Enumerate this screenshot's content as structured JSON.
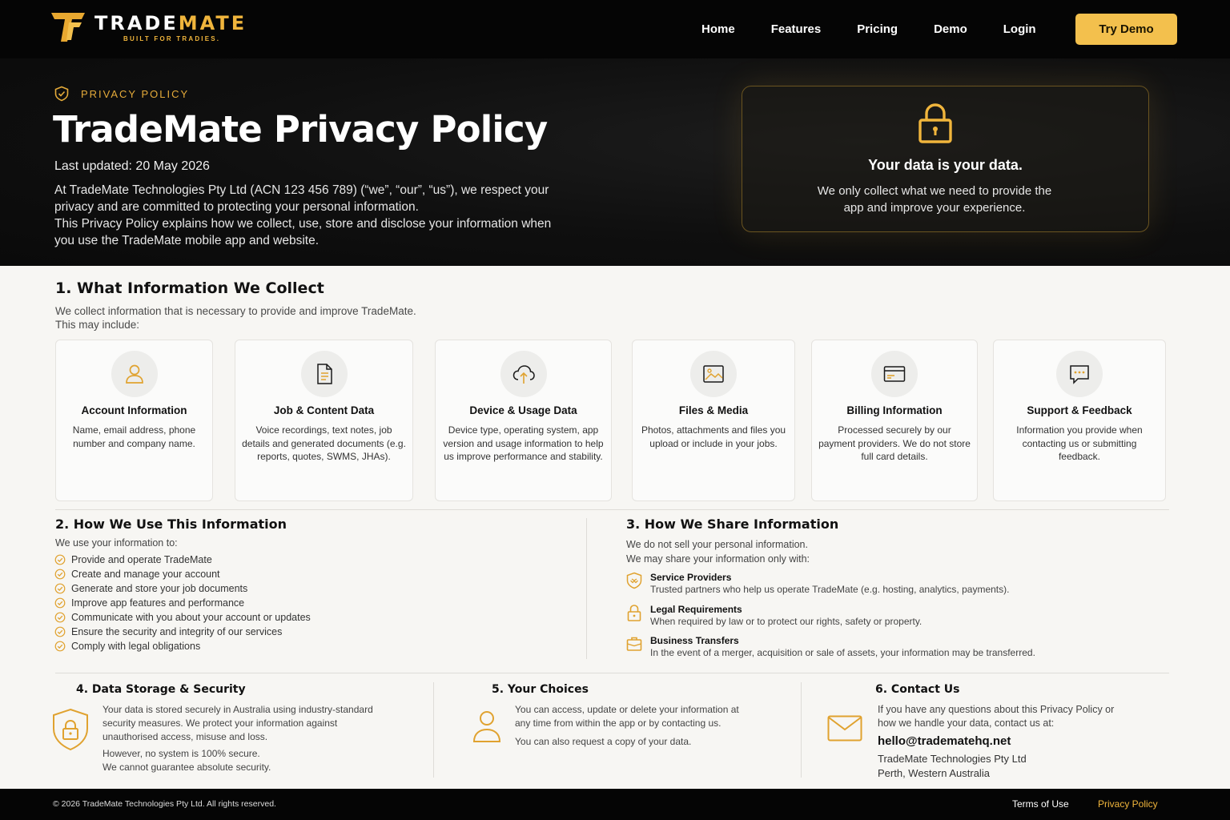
{
  "brand": {
    "name_part1": "TRADE",
    "name_part2": "MATE",
    "tagline": "BUILT FOR TRADIES."
  },
  "nav": {
    "links": [
      "Home",
      "Features",
      "Pricing",
      "Demo",
      "Login"
    ],
    "cta": "Try Demo"
  },
  "hero": {
    "eyebrow": "PRIVACY POLICY",
    "title": "TradeMate Privacy Policy",
    "updated": "Last updated: 20 May 2026",
    "paragraph1": "At TradeMate Technologies Pty Ltd (ACN 123 456 789) (“we”, “our”, “us”), we respect your privacy and are committed to protecting your personal information.",
    "paragraph2": "This Privacy Policy explains how we collect, use, store and disclose your information when you use the TradeMate mobile app and website.",
    "card_title": "Your data is your data.",
    "card_text": "We only collect what we need to provide the app and improve your experience."
  },
  "section1": {
    "title": "1. What Information We Collect",
    "intro1": "We collect information that is necessary to provide and improve TradeMate.",
    "intro2": "This may include:",
    "cards": [
      {
        "title": "Account Information",
        "icon": "user-icon",
        "text": "Name, email address, phone number and company name."
      },
      {
        "title": "Job & Content Data",
        "icon": "document-icon",
        "text": "Voice recordings, text notes, job details and generated documents (e.g. reports, quotes, SWMS, JHAs)."
      },
      {
        "title": "Device & Usage Data",
        "icon": "cloud-upload-icon",
        "text": "Device type, operating system, app version and usage information to help us improve performance and stability."
      },
      {
        "title": "Files & Media",
        "icon": "image-icon",
        "text": "Photos, attachments and files you upload or include in your jobs."
      },
      {
        "title": "Billing Information",
        "icon": "credit-card-icon",
        "text": "Processed securely by our payment providers. We do not store full card details."
      },
      {
        "title": "Support & Feedback",
        "icon": "chat-icon",
        "text": "Information you provide when contacting us or submitting feedback."
      }
    ]
  },
  "section2": {
    "title": "2. How We Use This Information",
    "intro": "We use your information to:",
    "items": [
      "Provide and operate TradeMate",
      "Create and manage your account",
      "Generate and store your job documents",
      "Improve app features and performance",
      "Communicate with you about your account or updates",
      "Ensure the security and integrity of our services",
      "Comply with legal obligations"
    ]
  },
  "section3": {
    "title": "3. How We Share Information",
    "intro1": "We do not sell your personal information.",
    "intro2": "We may share your information only with:",
    "items": [
      {
        "title": "Service Providers",
        "icon": "handshake-shield-icon",
        "text": "Trusted partners who help us operate TradeMate (e.g. hosting, analytics, payments)."
      },
      {
        "title": "Legal Requirements",
        "icon": "lock-icon",
        "text": "When required by law or to protect our rights, safety or property."
      },
      {
        "title": "Business Transfers",
        "icon": "briefcase-icon",
        "text": "In the event of a merger, acquisition or sale of assets, your information may be transferred."
      }
    ]
  },
  "section4": {
    "title": "4. Data Storage & Security",
    "text1": "Your data is stored securely in Australia using industry-standard security measures. We protect your information against unauthorised access, misuse and loss.",
    "text2": "However, no system is 100% secure.",
    "text3": "We cannot guarantee absolute security."
  },
  "section5": {
    "title": "5. Your Choices",
    "text1": "You can access, update or delete your information at any time from within the app or by contacting us.",
    "text2": "You can also request a copy of your data."
  },
  "section6": {
    "title": "6. Contact Us",
    "text": "If you have any questions about this Privacy Policy or how we handle your data, contact us at:",
    "email": "hello@tradematehq.net",
    "company": "TradeMate Technologies Pty Ltd",
    "location": "Perth, Western Australia"
  },
  "footer": {
    "copyright": "© 2026 TradeMate Technologies Pty Ltd. All rights reserved.",
    "terms": "Terms of Use",
    "privacy": "Privacy Policy"
  },
  "colors": {
    "accent": "#f0b53c",
    "dark": "#050505",
    "background": "#f7f6f3"
  }
}
